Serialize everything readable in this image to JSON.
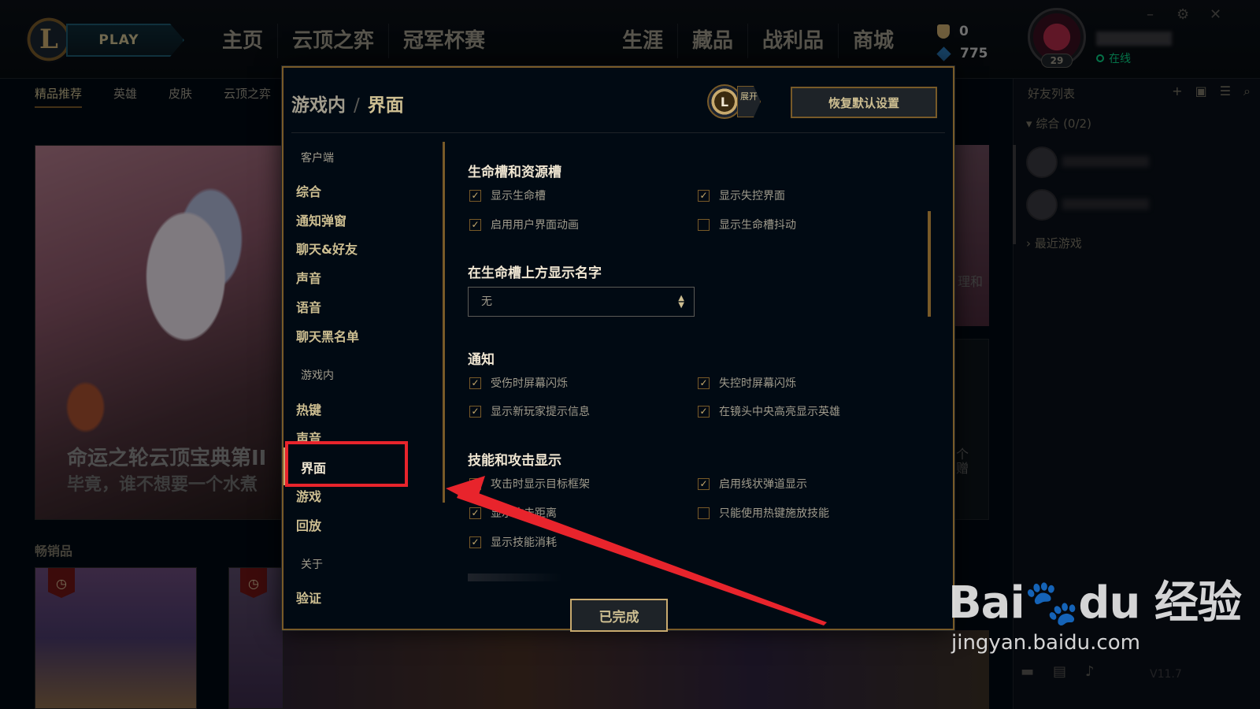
{
  "topbar": {
    "logo": "L",
    "play_label": "PLAY",
    "nav_left": [
      "主页",
      "云顶之弈",
      "冠军杯赛"
    ],
    "nav_right": [
      "生涯",
      "藏品",
      "战利品",
      "商城"
    ],
    "blue_essence": "0",
    "riot_points": "775",
    "level": "29",
    "status": "在线",
    "window_controls": [
      "–",
      "⚙",
      "✕"
    ]
  },
  "subnav": [
    "精品推荐",
    "英雄",
    "皮肤",
    "云顶之弈"
  ],
  "hero": {
    "title": "命运之轮云顶宝典第II",
    "subtitle": "毕竟，谁不想要一个水煮"
  },
  "bestsellers_label": "畅销品",
  "side_glyphs": {
    "a": "理和",
    "b": "个赠"
  },
  "friends": {
    "title": "好友列表",
    "group": "综合 (0/2)",
    "recent": "最近游戏"
  },
  "modal": {
    "breadcrumb_parent": "游戏内",
    "breadcrumb_sep": "/",
    "breadcrumb_current": "界面",
    "expand_badge": "展开",
    "reset_label": "恢复默认设置",
    "done_label": "已完成",
    "sidebar": {
      "client_category": "客户端",
      "client_items": [
        "综合",
        "通知弹窗",
        "聊天&好友",
        "声音",
        "语音",
        "聊天黑名单"
      ],
      "ingame_category": "游戏内",
      "ingame_items": [
        "热键",
        "声音",
        "界面",
        "游戏",
        "回放"
      ],
      "about_category": "关于",
      "about_items": [
        "验证"
      ]
    },
    "sections": {
      "health": {
        "title": "生命槽和资源槽",
        "options": [
          {
            "label": "显示生命槽",
            "checked": true
          },
          {
            "label": "显示失控界面",
            "checked": true
          },
          {
            "label": "启用用户界面动画",
            "checked": true
          },
          {
            "label": "显示生命槽抖动",
            "checked": false
          }
        ]
      },
      "names": {
        "title": "在生命槽上方显示名字",
        "select_value": "无"
      },
      "notify": {
        "title": "通知",
        "options": [
          {
            "label": "受伤时屏幕闪烁",
            "checked": true
          },
          {
            "label": "失控时屏幕闪烁",
            "checked": true
          },
          {
            "label": "显示新玩家提示信息",
            "checked": true
          },
          {
            "label": "在镜头中央高亮显示英雄",
            "checked": true
          }
        ]
      },
      "skills": {
        "title": "技能和攻击显示",
        "options": [
          {
            "label": "攻击时显示目标框架",
            "checked": true
          },
          {
            "label": "启用线状弹道显示",
            "checked": true
          },
          {
            "label": "显示攻击距离",
            "checked": true
          },
          {
            "label": "只能使用热键施放技能",
            "checked": false
          },
          {
            "label": "显示技能消耗",
            "checked": true
          }
        ]
      }
    }
  },
  "watermark": {
    "brand": "Bai🐾du 经验",
    "url": "jingyan.baidu.com"
  },
  "colors": {
    "gold": "#c8aa6e",
    "annotation_red": "#e8242c",
    "online_green": "#0acf83"
  }
}
